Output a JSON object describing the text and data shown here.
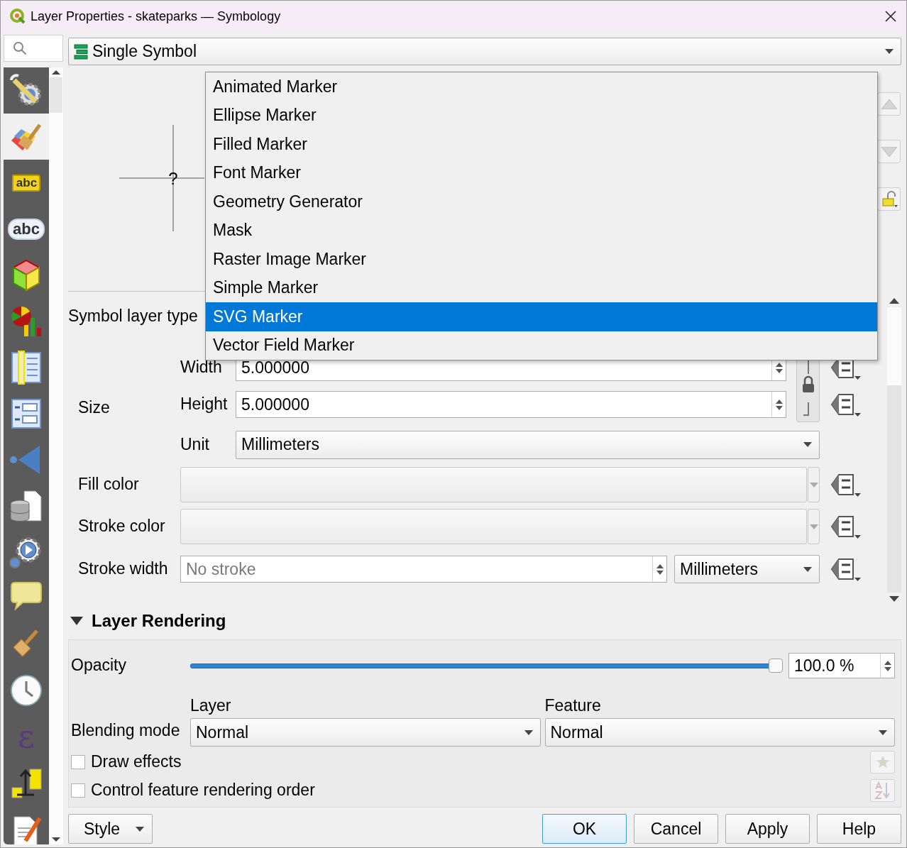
{
  "window": {
    "title": "Layer Properties - skateparks — Symbology"
  },
  "sidebar": {
    "items": [
      {
        "selected": false
      },
      {
        "selected": true
      },
      {
        "selected": false,
        "glyph": "abc"
      },
      {
        "selected": false,
        "glyph": "abc"
      },
      {
        "selected": false
      },
      {
        "selected": false
      },
      {
        "selected": false
      },
      {
        "selected": false
      },
      {
        "selected": false
      },
      {
        "selected": false
      },
      {
        "selected": false
      },
      {
        "selected": false
      },
      {
        "selected": false
      },
      {
        "selected": false
      },
      {
        "selected": false,
        "glyph": "ε"
      },
      {
        "selected": false
      },
      {
        "selected": false
      }
    ]
  },
  "renderer": {
    "value": "Single Symbol"
  },
  "preview": {
    "glyph": "?",
    "symbol_locked": false
  },
  "symbol_layer": {
    "label": "Symbol layer type",
    "popup": [
      {
        "label": "Animated Marker",
        "selected": false
      },
      {
        "label": "Ellipse Marker",
        "selected": false
      },
      {
        "label": "Filled Marker",
        "selected": false
      },
      {
        "label": "Font Marker",
        "selected": false
      },
      {
        "label": "Geometry Generator",
        "selected": false
      },
      {
        "label": "Mask",
        "selected": false
      },
      {
        "label": "Raster Image Marker",
        "selected": false
      },
      {
        "label": "Simple Marker",
        "selected": false
      },
      {
        "label": "SVG Marker",
        "selected": true
      },
      {
        "label": "Vector Field Marker",
        "selected": false
      }
    ]
  },
  "size": {
    "label": "Size",
    "locked": true,
    "width": {
      "label": "Width",
      "value": "5.000000"
    },
    "height": {
      "label": "Height",
      "value": "5.000000"
    },
    "unit": {
      "label": "Unit",
      "value": "Millimeters"
    }
  },
  "fill_color": {
    "label": "Fill color"
  },
  "stroke_color": {
    "label": "Stroke color"
  },
  "stroke_width": {
    "label": "Stroke width",
    "value": "No stroke",
    "unit": "Millimeters"
  },
  "layer_rendering": {
    "title": "Layer Rendering",
    "expanded": true,
    "opacity": {
      "label": "Opacity",
      "level": 1,
      "value": "100.0 %"
    },
    "blending": {
      "label": "Blending mode",
      "layer": {
        "label": "Layer",
        "value": "Normal"
      },
      "feature": {
        "label": "Feature",
        "value": "Normal"
      }
    },
    "options": [
      {
        "label": "Draw effects",
        "checked": false
      },
      {
        "label": "Control feature rendering order",
        "checked": false
      }
    ]
  },
  "buttons": [
    {
      "label": "Style",
      "kind": "menu"
    },
    {
      "label": "OK",
      "kind": "default"
    },
    {
      "label": "Cancel",
      "kind": "plain"
    },
    {
      "label": "Apply",
      "kind": "plain"
    },
    {
      "label": "Help",
      "kind": "plain"
    }
  ]
}
